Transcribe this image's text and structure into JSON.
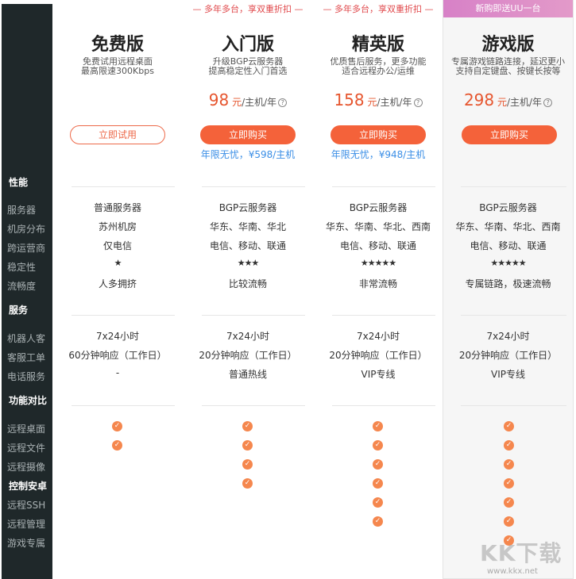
{
  "sidebar": {
    "sections": [
      {
        "title": "性能",
        "items": [
          "服务器",
          "机房分布",
          "跨运营商",
          "稳定性",
          "流畅度"
        ]
      },
      {
        "title": "服务",
        "items": [
          "机器人客",
          "客服工单",
          "电话服务"
        ]
      },
      {
        "title": "功能对比",
        "items": [
          "远程桌面",
          "远程文件",
          "远程摄像",
          "控制安卓",
          "远程SSH",
          "远程管理",
          "游戏专属"
        ]
      }
    ]
  },
  "plans": [
    {
      "ribbon": "",
      "title": "免费版",
      "desc": [
        "免费试用远程桌面",
        "最高限速300Kbps"
      ],
      "price": "",
      "unit": "",
      "per": "",
      "button": "立即试用",
      "note": "",
      "perf": [
        "普通服务器",
        "苏州机房",
        "仅电信",
        "★",
        "人多拥挤"
      ],
      "service": [
        "7x24小时",
        "60分钟响应（工作日）",
        "-"
      ],
      "features": [
        true,
        true,
        false,
        false,
        false,
        false,
        false
      ]
    },
    {
      "ribbon": "多年多台，享双重折扣",
      "title": "入门版",
      "desc": [
        "升级BGP云服务器",
        "提高稳定性入门首选"
      ],
      "price": "98",
      "unit": "元",
      "per": "/主机/年",
      "button": "立即购买",
      "note": "年限无忧，¥598/主机",
      "perf": [
        "BGP云服务器",
        "华东、华南、华北",
        "电信、移动、联通",
        "★★★",
        "比较流畅"
      ],
      "service": [
        "7x24小时",
        "20分钟响应（工作日）",
        "普通热线"
      ],
      "features": [
        true,
        true,
        true,
        true,
        false,
        false,
        false
      ]
    },
    {
      "ribbon": "多年多台，享双重折扣",
      "title": "精英版",
      "desc": [
        "优质售后服务，更多功能",
        "适合远程办公/运维"
      ],
      "price": "158",
      "unit": "元",
      "per": "/主机/年",
      "button": "立即购买",
      "note": "年限无忧，¥948/主机",
      "perf": [
        "BGP云服务器",
        "华东、华南、华北、西南",
        "电信、移动、联通",
        "★★★★★",
        "非常流畅"
      ],
      "service": [
        "7x24小时",
        "20分钟响应（工作日）",
        "VIP专线"
      ],
      "features": [
        true,
        true,
        true,
        true,
        true,
        true,
        false
      ]
    },
    {
      "ribbon": "新购即送UU一台",
      "title": "游戏版",
      "desc": [
        "专属游戏链路连接，延迟更小",
        "支持自定键盘、按键长按等"
      ],
      "price": "298",
      "unit": "元",
      "per": "/主机/年",
      "button": "立即购买",
      "note": "",
      "perf": [
        "BGP云服务器",
        "华东、华南、华北、西南",
        "电信、移动、联通",
        "★★★★★",
        "专属链路，极速流畅"
      ],
      "service": [
        "7x24小时",
        "20分钟响应（工作日）",
        "VIP专线"
      ],
      "features": [
        true,
        true,
        true,
        true,
        true,
        true,
        true
      ]
    }
  ],
  "watermark": {
    "text": "KK下载",
    "url": "www.kkx.net"
  },
  "colors": {
    "accent": "#f4623a",
    "sidebar": "#1f282a",
    "link": "#3a8ee6",
    "ribbon_pink": "#d781c7"
  }
}
